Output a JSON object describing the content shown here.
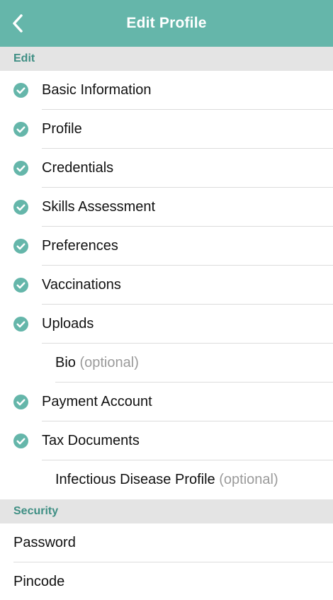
{
  "header": {
    "title": "Edit Profile",
    "accent_color": "#65b6aa",
    "back_icon": "chevron-left-icon"
  },
  "sections": {
    "edit": {
      "title": "Edit",
      "items": [
        {
          "label": "Basic Information",
          "completed": true
        },
        {
          "label": "Profile",
          "completed": true
        },
        {
          "label": "Credentials",
          "completed": true
        },
        {
          "label": "Skills Assessment",
          "completed": true
        },
        {
          "label": "Preferences",
          "completed": true
        },
        {
          "label": "Vaccinations",
          "completed": true
        },
        {
          "label": "Uploads",
          "completed": true
        },
        {
          "label": "Bio",
          "suffix": "(optional)",
          "completed": false
        },
        {
          "label": "Payment Account",
          "completed": true
        },
        {
          "label": "Tax Documents",
          "completed": true
        },
        {
          "label": "Infectious Disease Profile",
          "suffix": "(optional)",
          "completed": false
        }
      ]
    },
    "security": {
      "title": "Security",
      "items": [
        {
          "label": "Password"
        },
        {
          "label": "Pincode"
        }
      ]
    }
  },
  "colors": {
    "check": "#65b6aa",
    "section_header_text": "#3f8f84",
    "section_header_bg": "#e4e4e4",
    "optional_text": "#9a9a9a"
  }
}
